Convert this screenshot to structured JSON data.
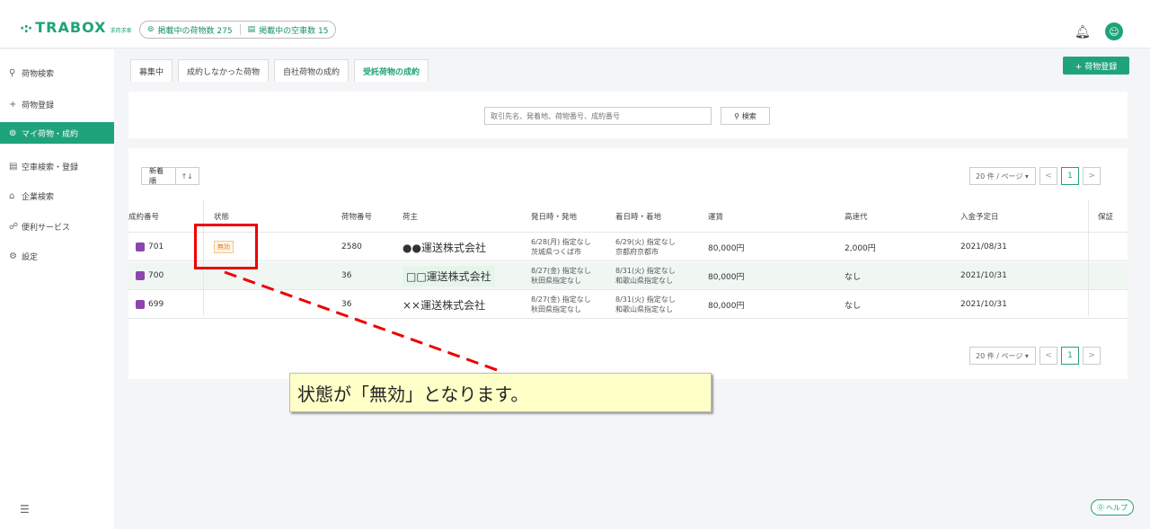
{
  "header": {
    "logo_mark": "·:·",
    "logo_text": "TRABOX",
    "logo_sub": "求荷求車",
    "stats": [
      {
        "icon": "cargo-icon",
        "label": "掲載中の荷物数 275"
      },
      {
        "icon": "truck-icon",
        "label": "掲載中の空車数 15"
      }
    ]
  },
  "sidebar": {
    "items": [
      {
        "icon": "search-icon",
        "label": "荷物検索"
      },
      {
        "icon": "plus-icon",
        "label": "荷物登録"
      },
      {
        "icon": "package-icon",
        "label": "マイ荷物・成約"
      },
      {
        "icon": "truck-icon",
        "label": "空車検索・登録"
      },
      {
        "icon": "building-icon",
        "label": "企業検索"
      },
      {
        "icon": "people-icon",
        "label": "便利サービス"
      },
      {
        "icon": "gear-icon",
        "label": "設定"
      }
    ],
    "active_index": 2
  },
  "tabs": [
    "募集中",
    "成約しなかった荷物",
    "自社荷物の成約",
    "受託荷物の成約"
  ],
  "active_tab": 3,
  "add_cargo_label": "+ 荷物登録",
  "search": {
    "placeholder": "取引先名、発着地、荷物番号、成約番号",
    "button_label": "検索"
  },
  "sort": {
    "value": "新着順",
    "arrow": "↑↓"
  },
  "pager": {
    "size_label": "20 件 / ページ",
    "current": "1",
    "prev": "<",
    "next": ">"
  },
  "table": {
    "headers": [
      "成約番号",
      "状態",
      "荷物番号",
      "荷主",
      "発日時・発地",
      "着日時・着地",
      "運賃",
      "高速代",
      "入金予定日",
      "保証"
    ],
    "rows": [
      {
        "contract": "701",
        "status": "無効",
        "cargo": "2580",
        "shipper": "●●運送株式会社",
        "dep1": "6/28(月) 指定なし",
        "dep2": "茨城県つくば市",
        "arr1": "6/29(火) 指定なし",
        "arr2": "京都府京都市",
        "fare": "80,000円",
        "toll": "2,000円",
        "payday": "2021/08/31",
        "guarantee": ""
      },
      {
        "contract": "700",
        "status": "",
        "cargo": "36",
        "shipper": "□□運送株式会社",
        "dep1": "8/27(金) 指定なし",
        "dep2": "秋田県指定なし",
        "arr1": "8/31(火) 指定なし",
        "arr2": "和歌山県指定なし",
        "fare": "80,000円",
        "toll": "なし",
        "payday": "2021/10/31",
        "guarantee": ""
      },
      {
        "contract": "699",
        "status": "",
        "cargo": "36",
        "shipper": "××運送株式会社",
        "dep1": "8/27(金) 指定なし",
        "dep2": "秋田県指定なし",
        "arr1": "8/31(火) 指定なし",
        "arr2": "和歌山県指定なし",
        "fare": "80,000円",
        "toll": "なし",
        "payday": "2021/10/31",
        "guarantee": ""
      }
    ]
  },
  "annotation": {
    "text": "状態が「無効」となります。"
  },
  "help_label": "ヘルプ",
  "colors": {
    "brand": "#1fa37a",
    "annotation_red": "#e00000",
    "callout_bg": "#ffffc8"
  }
}
